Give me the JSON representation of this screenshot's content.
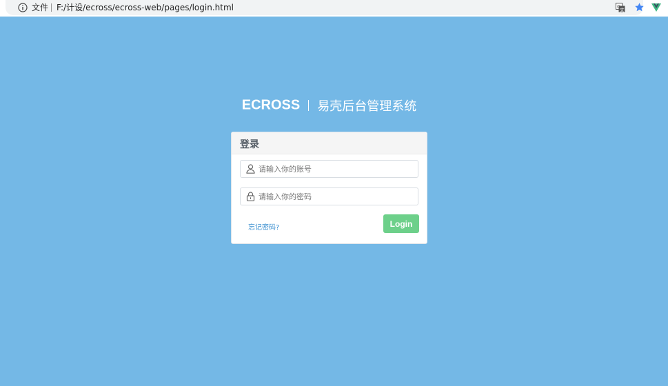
{
  "browser": {
    "address_label": "文件",
    "url": "F:/计设/ecross/ecross-web/pages/login.html"
  },
  "header": {
    "brand": "ECROSS",
    "subtitle": "易壳后台管理系统"
  },
  "login_panel": {
    "title": "登录",
    "username": {
      "value": "",
      "placeholder": "请输入你的账号"
    },
    "password": {
      "value": "",
      "placeholder": "请输入你的密码"
    },
    "forgot_link": "忘记密码?",
    "submit_label": "Login"
  },
  "colors": {
    "background": "#74b8e6",
    "login_button": "#6dd08a",
    "link": "#3a8fd0",
    "panel_header": "#f5f5f5"
  },
  "icons": {
    "address_info": "info-icon",
    "translate": "translate-icon",
    "bookmark": "star-icon",
    "extension": "vue-extension-icon",
    "username_field": "user-icon",
    "password_field": "lock-icon"
  }
}
